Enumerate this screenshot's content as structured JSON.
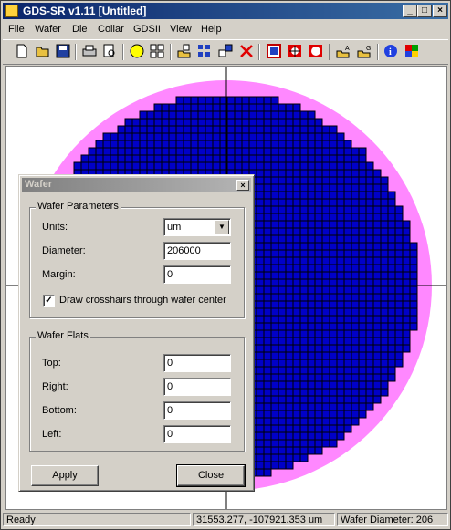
{
  "window": {
    "title": "GDS-SR v1.11 [Untitled]"
  },
  "menu": [
    "File",
    "Wafer",
    "Die",
    "Collar",
    "GDSII",
    "View",
    "Help"
  ],
  "toolbar": {
    "icons": [
      "new-icon",
      "open-icon",
      "save-icon",
      "print-icon",
      "print-preview-icon",
      "wafer-icon",
      "die-grid-icon",
      "import-icon",
      "array-icon",
      "scale-icon",
      "delete-icon",
      "collar-icon",
      "target-icon",
      "circle-icon",
      "export-a-icon",
      "export-g-icon",
      "info-icon",
      "palette-icon"
    ]
  },
  "canvas": {
    "colors": {
      "wafer_fill": "#ff88ff",
      "die_fill": "#0000c8",
      "die_border": "#000000",
      "background": "#ffffff"
    }
  },
  "dialog": {
    "title": "Wafer",
    "params": {
      "legend": "Wafer Parameters",
      "units_label": "Units:",
      "units_value": "um",
      "diameter_label": "Diameter:",
      "diameter_value": "206000",
      "margin_label": "Margin:",
      "margin_value": "0",
      "crosshair_label": "Draw crosshairs through wafer center",
      "crosshair_checked": true
    },
    "flats": {
      "legend": "Wafer Flats",
      "top_label": "Top:",
      "top_value": "0",
      "right_label": "Right:",
      "right_value": "0",
      "bottom_label": "Bottom:",
      "bottom_value": "0",
      "left_label": "Left:",
      "left_value": "0"
    },
    "apply_label": "Apply",
    "close_label": "Close"
  },
  "status": {
    "ready": "Ready",
    "coords": "31553.277, -107921.353 um",
    "diameter": "Wafer Diameter: 206"
  }
}
